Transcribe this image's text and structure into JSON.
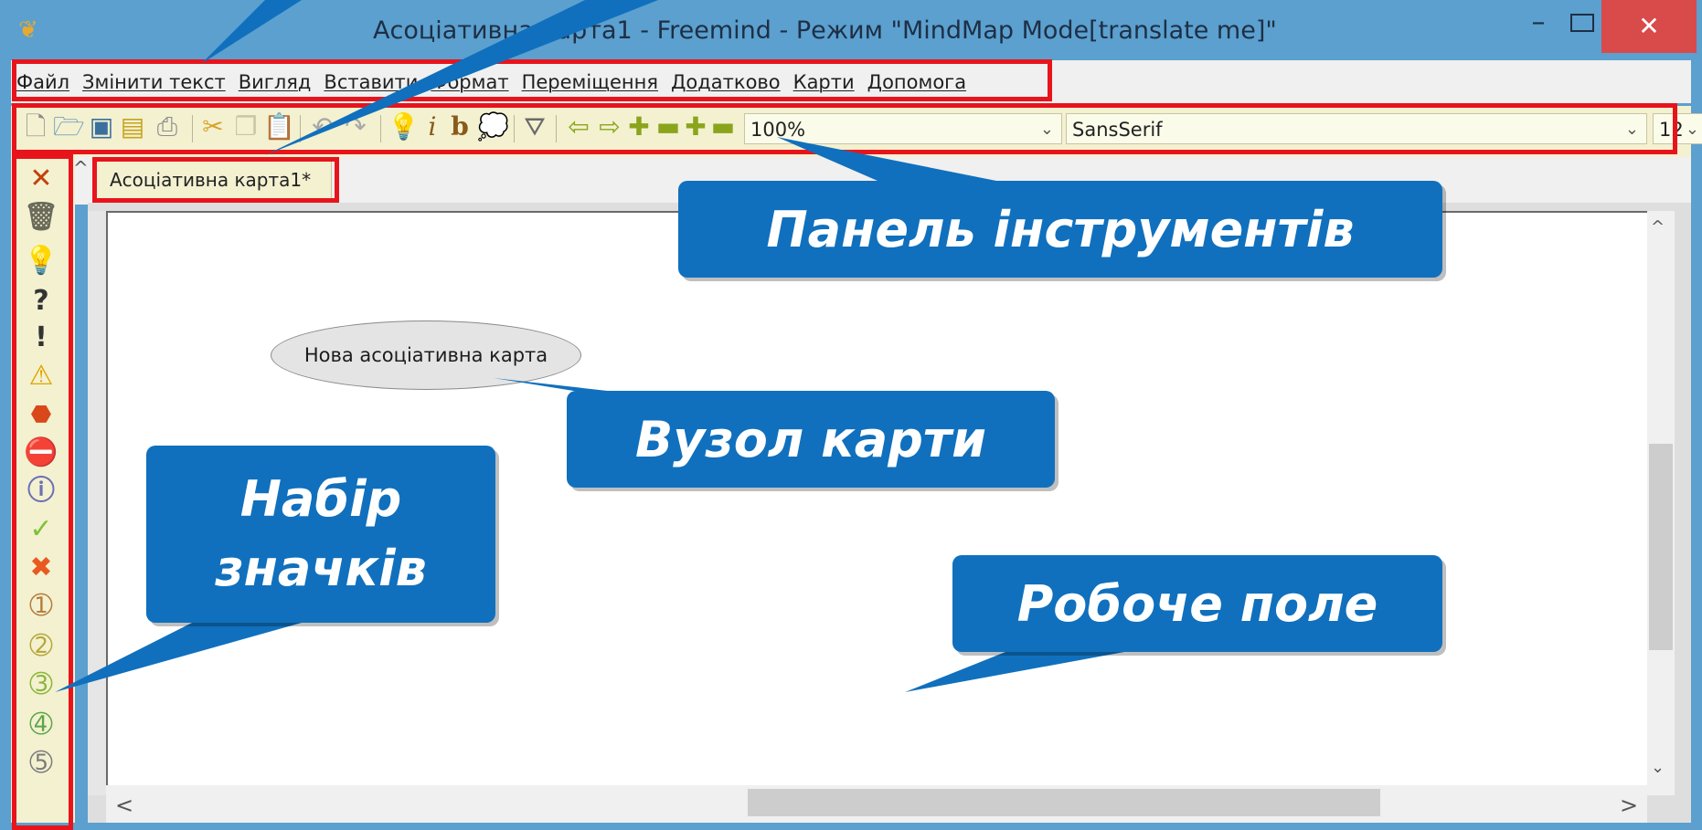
{
  "window": {
    "title": "Асоціативна карта1 - Freemind - Режим \"MindMap Mode[translate me]\"",
    "app_icon": "butterfly-icon",
    "minimize_icon": "minimize-icon",
    "maximize_icon": "maximize-icon",
    "close_icon": "close-icon",
    "close_glyph": "✕"
  },
  "menu": {
    "items": [
      "Файл",
      "Змінити текст",
      "Вигляд",
      "Вставити",
      "Формат",
      "Переміщення",
      "Додатково",
      "Карти",
      "Допомога"
    ]
  },
  "toolbar": {
    "icons": [
      "new-icon",
      "open-icon",
      "save-icon",
      "save-as-icon",
      "print-icon",
      "cut-icon",
      "copy-icon",
      "paste-icon",
      "undo-icon",
      "redo-icon",
      "idea-icon",
      "italic-icon",
      "bold-icon",
      "cloud-icon",
      "filter-icon",
      "back-icon",
      "forward-icon",
      "expand-icon",
      "collapse-icon",
      "expand-all-icon",
      "collapse-all-icon"
    ],
    "zoom": "100%",
    "font_family": "SansSerif",
    "font_size": "12"
  },
  "tabs": [
    {
      "label": "Асоціативна карта1*"
    }
  ],
  "side_icons": [
    "remove-last-icon",
    "delete-all-icon",
    "idea-icon",
    "question-icon",
    "exclamation-icon",
    "warning-icon",
    "stop-icon",
    "no-entry-icon",
    "info-icon",
    "checkmark-icon",
    "cross-icon",
    "priority-1-icon",
    "priority-2-icon",
    "priority-3-icon",
    "priority-4-icon",
    "priority-5-icon"
  ],
  "map": {
    "root_node": "Нова асоціативна карта"
  },
  "callouts": {
    "toolbar": "Панель інструментів",
    "node": "Вузол карти",
    "icons_line1": "Набір",
    "icons_line2": "значків",
    "workspace": "Робоче поле"
  },
  "colors": {
    "highlight": "#e8141c",
    "callout": "#1070bd",
    "toolbar_bg": "#f3f1d0"
  }
}
